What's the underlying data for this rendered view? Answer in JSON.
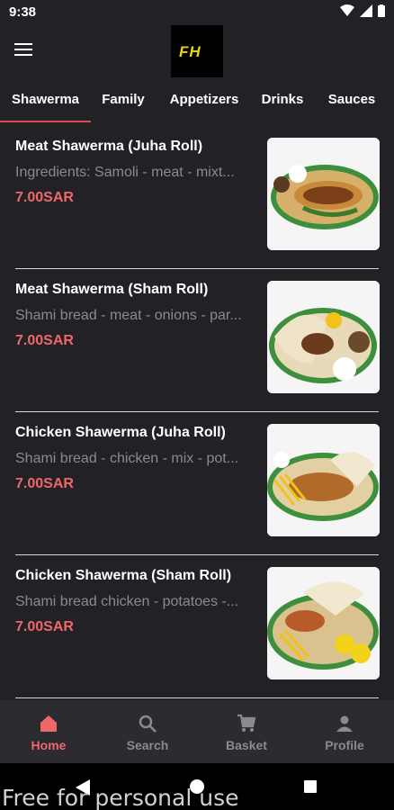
{
  "status": {
    "time": "9:38"
  },
  "tabs": [
    {
      "label": "Shawerma",
      "active": true
    },
    {
      "label": "Family",
      "active": false
    },
    {
      "label": "Appetizers",
      "active": false
    },
    {
      "label": "Drinks",
      "active": false
    },
    {
      "label": "Sauces",
      "active": false
    }
  ],
  "items": [
    {
      "title": "Meat Shawerma (Juha Roll)",
      "desc": "Ingredients: Samoli - meat - mixt...",
      "price": "7.00SAR"
    },
    {
      "title": "Meat Shawerma (Sham Roll)",
      "desc": "Shami bread - meat - onions - par...",
      "price": "7.00SAR"
    },
    {
      "title": "Chicken Shawerma (Juha Roll)",
      "desc": "Shami bread - chicken - mix - pot...",
      "price": "7.00SAR"
    },
    {
      "title": "Chicken Shawerma (Sham Roll)",
      "desc": "Shami bread chicken - potatoes -...",
      "price": "7.00SAR"
    }
  ],
  "nav": [
    {
      "label": "Home",
      "icon": "home-icon",
      "active": true
    },
    {
      "label": "Search",
      "icon": "search-icon",
      "active": false
    },
    {
      "label": "Basket",
      "icon": "cart-icon",
      "active": false
    },
    {
      "label": "Profile",
      "icon": "profile-icon",
      "active": false
    }
  ],
  "watermark": "Free for personal use",
  "colors": {
    "background": "#222226",
    "accent": "#f06767",
    "tab_indicator": "#e04a4a",
    "muted": "#8a8a8f"
  }
}
